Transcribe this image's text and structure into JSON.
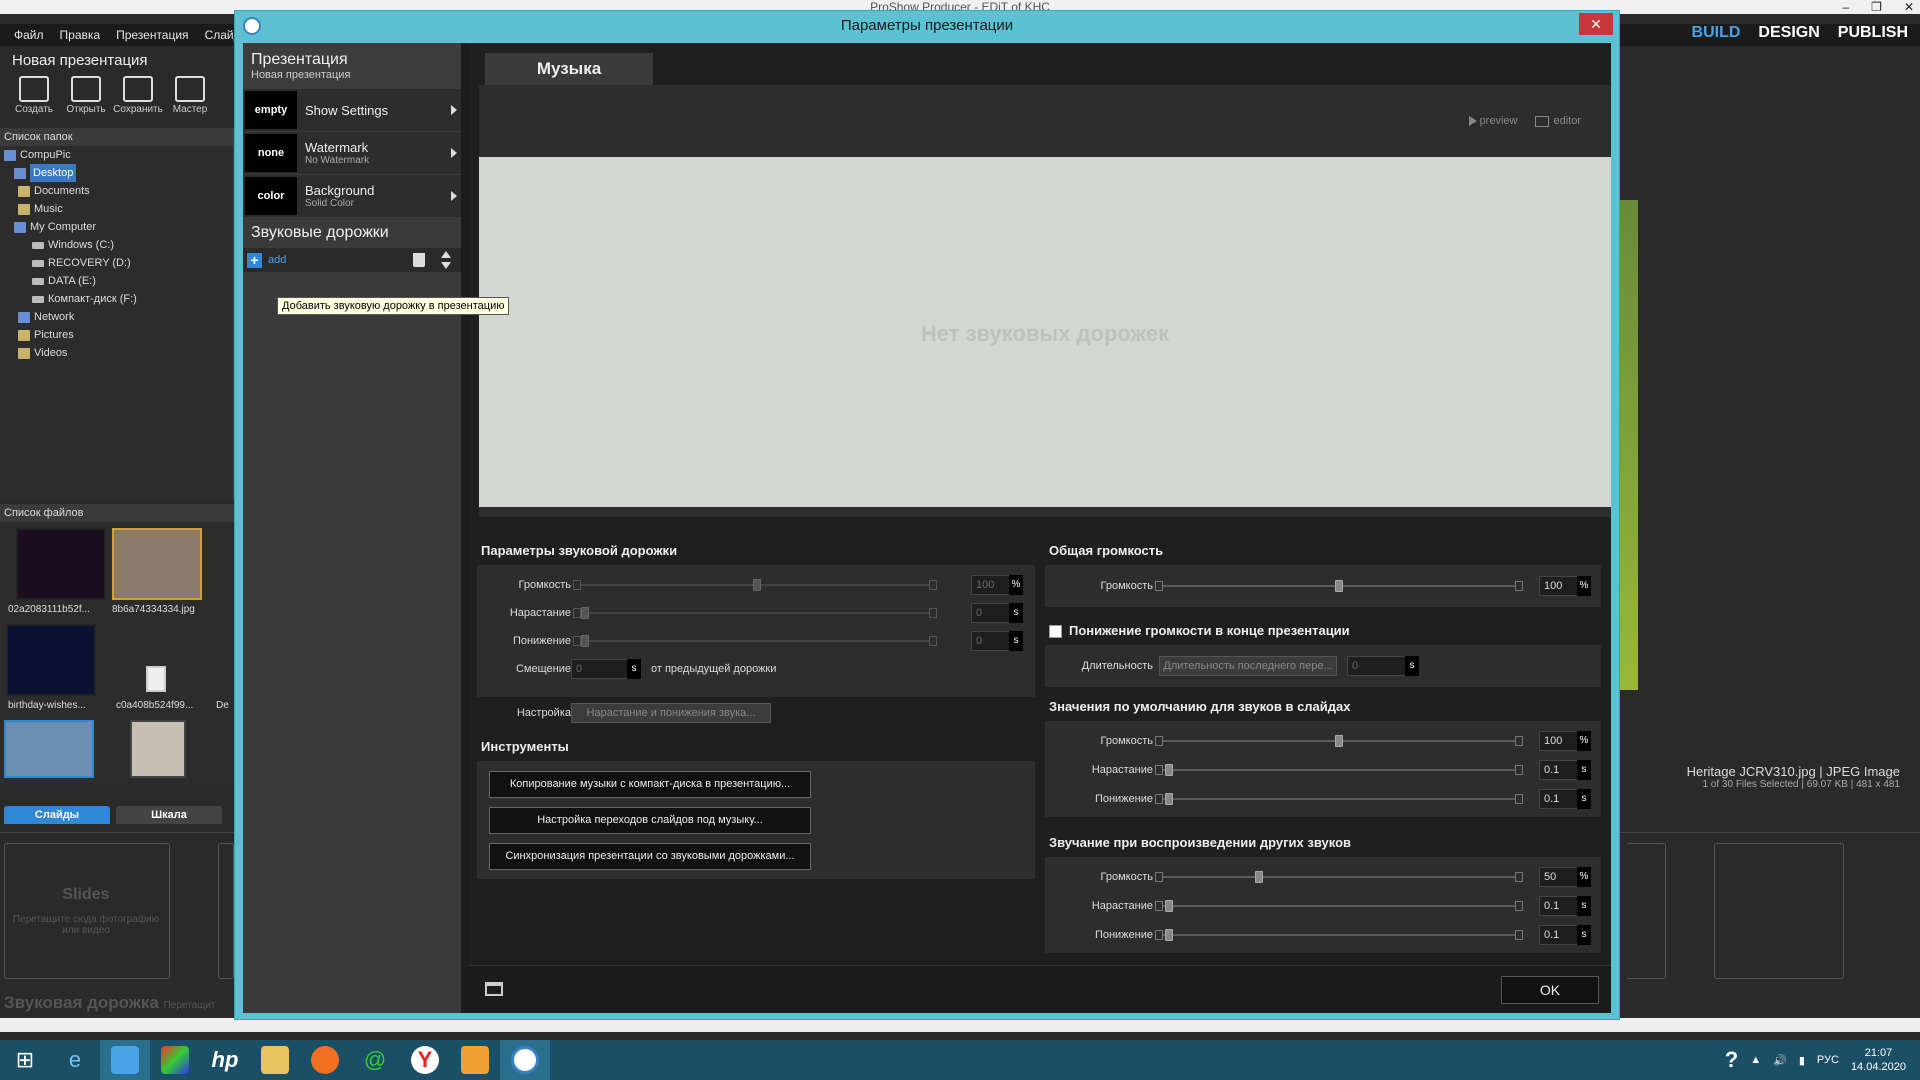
{
  "app": {
    "title": "ProShow Producer - EDiT of KHC",
    "menu": [
      "Файл",
      "Правка",
      "Презентация",
      "Слайд"
    ],
    "modes": [
      "BUILD",
      "DESIGN",
      "PUBLISH"
    ],
    "project_title": "Новая презентация",
    "toolbar": [
      "Создать",
      "Открыть",
      "Сохранить",
      "Мастер"
    ],
    "folders_header": "Список папок",
    "folders": [
      {
        "label": "CompuPic",
        "icon": "compupic-icon"
      },
      {
        "label": "Desktop",
        "icon": "folder-icon",
        "selected": true
      },
      {
        "label": "Documents",
        "icon": "folder-icon"
      },
      {
        "label": "Music",
        "icon": "folder-icon"
      },
      {
        "label": "My Computer",
        "icon": "computer-icon"
      },
      {
        "label": "Windows (C:)",
        "icon": "drive-icon"
      },
      {
        "label": "RECOVERY (D:)",
        "icon": "drive-icon"
      },
      {
        "label": "DATA (E:)",
        "icon": "drive-icon"
      },
      {
        "label": "Компакт-диск (F:)",
        "icon": "cd-drive-icon"
      },
      {
        "label": "Network",
        "icon": "network-icon"
      },
      {
        "label": "Pictures",
        "icon": "folder-icon"
      },
      {
        "label": "Videos",
        "icon": "folder-icon"
      }
    ],
    "files_header": "Список файлов",
    "files": [
      "02a2083111b52f...",
      "8b6a74334334.jpg",
      "birthday-wishes...",
      "c0a408b524f99...",
      "De"
    ],
    "bottom_tabs": [
      "Слайды",
      "Шкала"
    ],
    "slides_title": "Slides",
    "slides_hint": "Перетащите сюда фотографию или видео",
    "audio_track": "Звуковая дорожка",
    "audio_track_hint": "Перетащит",
    "selected_file": "Heritage JCRV310.jpg  |  JPEG Image",
    "selected_info": "1 of 30 Files Selected  |  69.07 KB  |  481 x 481"
  },
  "dialog": {
    "title": "Параметры презентации",
    "close": "✕",
    "sidebar": {
      "pres_title": "Презентация",
      "pres_sub": "Новая презентация",
      "items": [
        {
          "swatch": "empty",
          "label": "Show Settings",
          "sub": ""
        },
        {
          "swatch": "none",
          "label": "Watermark",
          "sub": "No Watermark"
        },
        {
          "swatch": "color",
          "label": "Background",
          "sub": "Solid Color"
        }
      ],
      "audio_title": "Звуковые дорожки",
      "add_label": "add",
      "tooltip": "Добавить звуковую дорожку в презентацию"
    },
    "tab": "Музыка",
    "preview_link": "preview",
    "editor_link": "editor",
    "no_tracks": "Нет звуковых дорожек",
    "track_params": {
      "title": "Параметры звуковой дорожки",
      "volume_label": "Громкость",
      "volume": "100",
      "volume_unit": "%",
      "fadein_label": "Нарастание",
      "fadein": "0",
      "fadein_unit": "s",
      "fadeout_label": "Понижение",
      "fadeout": "0",
      "fadeout_unit": "s",
      "offset_label": "Смещение",
      "offset": "0",
      "offset_unit": "s",
      "offset_suffix": "от предыдущей дорожки",
      "adjust_label": "Настройка",
      "adjust_button": "Нарастание и понижения звука..."
    },
    "tools": {
      "title": "Инструменты",
      "buttons": [
        "Копирование музыки с компакт-диска в презентацию...",
        "Настройка переходов слайдов под музыку...",
        "Синхронизация презентации со звуковыми дорожками..."
      ]
    },
    "master_volume": {
      "title": "Общая громкость",
      "volume_label": "Громкость",
      "volume": "100",
      "unit": "%",
      "level": 0.5
    },
    "fade_end": {
      "title": "Понижение громкости в конце презентации",
      "checked": false,
      "duration_label": "Длительность",
      "duration_button": "Длительность последнего пере...",
      "duration": "0",
      "unit": "s"
    },
    "slide_defaults": {
      "title": "Значения по умолчанию для звуков в слайдах",
      "volume_label": "Громкость",
      "volume": "100",
      "volume_unit": "%",
      "fadein_label": "Нарастание",
      "fadein": "0.1",
      "fadein_unit": "s",
      "fadeout_label": "Понижение",
      "fadeout": "0.1",
      "fadeout_unit": "s"
    },
    "other_sounds": {
      "title": "Звучание при воспроизведении других звуков",
      "volume_label": "Громкость",
      "volume": "50",
      "volume_unit": "%",
      "fadein_label": "Нарастание",
      "fadein": "0.1",
      "fadein_unit": "s",
      "fadeout_label": "Понижение",
      "fadeout": "0.1",
      "fadeout_unit": "s"
    },
    "ok": "OK"
  },
  "taskbar": {
    "lang": "РУС",
    "time": "21:07",
    "date": "14.04.2020"
  },
  "colors": {
    "dialog_frame": "#5bc2d4",
    "accent": "#2f87d6",
    "close": "#c7373b"
  }
}
